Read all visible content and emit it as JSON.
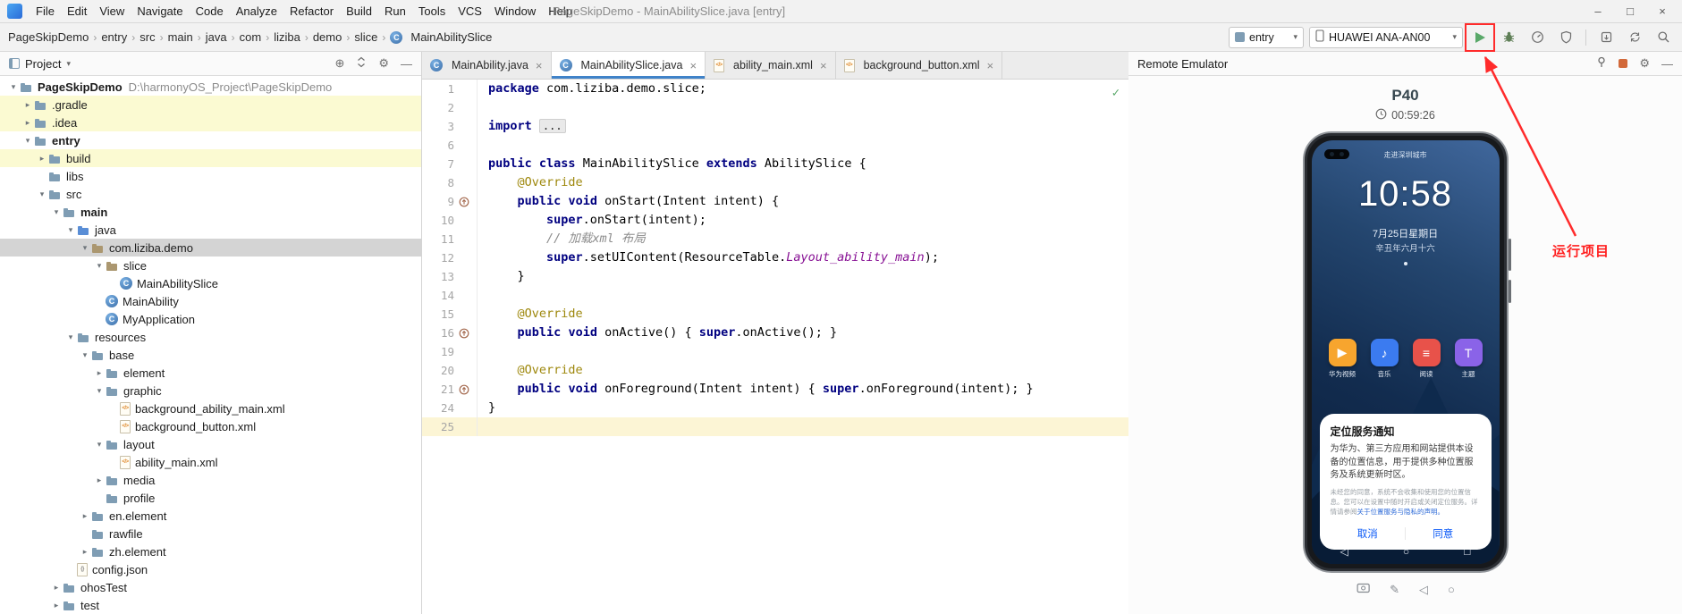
{
  "window": {
    "title": "PageSkipDemo - MainAbilitySlice.java [entry]",
    "menu_items": [
      "File",
      "Edit",
      "View",
      "Navigate",
      "Code",
      "Analyze",
      "Refactor",
      "Build",
      "Run",
      "Tools",
      "VCS",
      "Window",
      "Help"
    ],
    "controls": {
      "minimize": "–",
      "maximize": "□",
      "close": "×"
    }
  },
  "toolbar": {
    "breadcrumbs": [
      "PageSkipDemo",
      "entry",
      "src",
      "main",
      "java",
      "com",
      "liziba",
      "demo",
      "slice",
      "MainAbilitySlice"
    ],
    "run_config": "entry",
    "device": "HUAWEI ANA-AN00"
  },
  "project": {
    "header": "Project",
    "tree": [
      {
        "label": "PageSkipDemo",
        "sub": "D:\\harmonyOS_Project\\PageSkipDemo",
        "d": 0,
        "ic": "dir",
        "ch": "v",
        "bold": true
      },
      {
        "label": ".gradle",
        "d": 1,
        "ic": "dir",
        "ch": ">",
        "bg": "ex"
      },
      {
        "label": ".idea",
        "d": 1,
        "ic": "dir",
        "ch": ">",
        "bg": "ex"
      },
      {
        "label": "entry",
        "d": 1,
        "ic": "dir",
        "ch": "v",
        "bold": true
      },
      {
        "label": "build",
        "d": 2,
        "ic": "dir",
        "ch": ">",
        "bg": "ex"
      },
      {
        "label": "libs",
        "d": 2,
        "ic": "dir",
        "ch": ""
      },
      {
        "label": "src",
        "d": 2,
        "ic": "dir",
        "ch": "v"
      },
      {
        "label": "main",
        "d": 3,
        "ic": "dir",
        "ch": "v",
        "bold": true
      },
      {
        "label": "java",
        "d": 4,
        "ic": "dirsrc",
        "ch": "v"
      },
      {
        "label": "com.liziba.demo",
        "d": 5,
        "ic": "pkg",
        "ch": "v",
        "bg": "sel"
      },
      {
        "label": "slice",
        "d": 6,
        "ic": "pkg",
        "ch": "v"
      },
      {
        "label": "MainAbilitySlice",
        "d": 7,
        "ic": "cls",
        "ch": ""
      },
      {
        "label": "MainAbility",
        "d": 6,
        "ic": "cls",
        "ch": ""
      },
      {
        "label": "MyApplication",
        "d": 6,
        "ic": "cls",
        "ch": ""
      },
      {
        "label": "resources",
        "d": 4,
        "ic": "dir",
        "ch": "v"
      },
      {
        "label": "base",
        "d": 5,
        "ic": "dir",
        "ch": "v"
      },
      {
        "label": "element",
        "d": 6,
        "ic": "dir",
        "ch": ">"
      },
      {
        "label": "graphic",
        "d": 6,
        "ic": "dir",
        "ch": "v"
      },
      {
        "label": "background_ability_main.xml",
        "d": 7,
        "ic": "xml",
        "ch": ""
      },
      {
        "label": "background_button.xml",
        "d": 7,
        "ic": "xml",
        "ch": ""
      },
      {
        "label": "layout",
        "d": 6,
        "ic": "dir",
        "ch": "v"
      },
      {
        "label": "ability_main.xml",
        "d": 7,
        "ic": "xml",
        "ch": ""
      },
      {
        "label": "media",
        "d": 6,
        "ic": "dir",
        "ch": ">"
      },
      {
        "label": "profile",
        "d": 6,
        "ic": "dir",
        "ch": ""
      },
      {
        "label": "en.element",
        "d": 5,
        "ic": "dir",
        "ch": ">"
      },
      {
        "label": "rawfile",
        "d": 5,
        "ic": "dir",
        "ch": ""
      },
      {
        "label": "zh.element",
        "d": 5,
        "ic": "dir",
        "ch": ">"
      },
      {
        "label": "config.json",
        "d": 4,
        "ic": "json",
        "ch": ""
      },
      {
        "label": "ohosTest",
        "d": 3,
        "ic": "dir",
        "ch": ">"
      },
      {
        "label": "test",
        "d": 3,
        "ic": "dir",
        "ch": ">"
      }
    ]
  },
  "editor": {
    "tabs": [
      {
        "label": "MainAbility.java",
        "ic": "cls"
      },
      {
        "label": "MainAbilitySlice.java",
        "ic": "cls",
        "active": true
      },
      {
        "label": "ability_main.xml",
        "ic": "xml"
      },
      {
        "label": "background_button.xml",
        "ic": "xml"
      }
    ],
    "lines": [
      {
        "n": 1,
        "t": [
          [
            "kw",
            "package"
          ],
          [
            "pl",
            " com.liziba.demo.slice;"
          ]
        ]
      },
      {
        "n": 2,
        "t": []
      },
      {
        "n": 3,
        "t": [
          [
            "kw",
            "import"
          ],
          [
            "pl",
            " "
          ],
          [
            "fd",
            "..."
          ]
        ]
      },
      {
        "n": 6,
        "t": []
      },
      {
        "n": 7,
        "t": [
          [
            "kw",
            "public"
          ],
          [
            "pl",
            " "
          ],
          [
            "kw",
            "class"
          ],
          [
            "pl",
            " MainAbilitySlice "
          ],
          [
            "kw",
            "extends"
          ],
          [
            "pl",
            " AbilitySlice {"
          ]
        ]
      },
      {
        "n": 8,
        "t": [
          [
            "pl",
            "    "
          ],
          [
            "an",
            "@Override"
          ]
        ]
      },
      {
        "n": 9,
        "g": "o",
        "t": [
          [
            "pl",
            "    "
          ],
          [
            "kw",
            "public"
          ],
          [
            "pl",
            " "
          ],
          [
            "kw",
            "void"
          ],
          [
            "pl",
            " onStart(Intent intent) {"
          ]
        ]
      },
      {
        "n": 10,
        "t": [
          [
            "pl",
            "        "
          ],
          [
            "kw",
            "super"
          ],
          [
            "pl",
            ".onStart(intent);"
          ]
        ]
      },
      {
        "n": 11,
        "t": [
          [
            "pl",
            "        "
          ],
          [
            "cm",
            "// 加载xml 布局"
          ]
        ]
      },
      {
        "n": 12,
        "t": [
          [
            "pl",
            "        "
          ],
          [
            "kw",
            "super"
          ],
          [
            "pl",
            ".setUIContent(ResourceTable."
          ],
          [
            "st",
            "Layout_ability_main"
          ],
          [
            "pl",
            ");"
          ]
        ]
      },
      {
        "n": 13,
        "t": [
          [
            "pl",
            "    }"
          ]
        ]
      },
      {
        "n": 14,
        "t": []
      },
      {
        "n": 15,
        "t": [
          [
            "pl",
            "    "
          ],
          [
            "an",
            "@Override"
          ]
        ]
      },
      {
        "n": 16,
        "g": "o",
        "t": [
          [
            "pl",
            "    "
          ],
          [
            "kw",
            "public"
          ],
          [
            "pl",
            " "
          ],
          [
            "kw",
            "void"
          ],
          [
            "pl",
            " onActive() { "
          ],
          [
            "kw",
            "super"
          ],
          [
            "pl",
            ".onActive(); }"
          ]
        ]
      },
      {
        "n": 19,
        "t": []
      },
      {
        "n": 20,
        "t": [
          [
            "pl",
            "    "
          ],
          [
            "an",
            "@Override"
          ]
        ]
      },
      {
        "n": 21,
        "g": "o",
        "t": [
          [
            "pl",
            "    "
          ],
          [
            "kw",
            "public"
          ],
          [
            "pl",
            " "
          ],
          [
            "kw",
            "void"
          ],
          [
            "pl",
            " onForeground(Intent intent) { "
          ],
          [
            "kw",
            "super"
          ],
          [
            "pl",
            ".onForeground(intent); }"
          ]
        ]
      },
      {
        "n": 24,
        "t": [
          [
            "pl",
            "}"
          ]
        ]
      },
      {
        "n": 25,
        "cur": true,
        "t": []
      }
    ]
  },
  "emulator": {
    "title": "Remote Emulator",
    "device": "P40",
    "uptime": "00:59:26",
    "phone": {
      "carrier_text": "走进深圳城市",
      "time": "10:58",
      "date": "7月25日星期日",
      "lunar": "辛丑年六月十六",
      "apps": [
        {
          "label": "华为视频",
          "color": "#f7a52e",
          "glyph": "▶"
        },
        {
          "label": "音乐",
          "color": "#3b7bf0",
          "glyph": "♪"
        },
        {
          "label": "阅读",
          "color": "#e8524a",
          "glyph": "≡"
        },
        {
          "label": "主题",
          "color": "#8a63e8",
          "glyph": "T"
        }
      ],
      "dialog": {
        "title": "定位服务通知",
        "body": "为华为、第三方应用和网站提供本设备的位置信息，用于提供多种位置服务及系统更新时区。",
        "note": "未经您的同意，系统不会收集和使用您的位置信息。您可以在设置中随时开启或关闭定位服务。详情请参阅",
        "link": "关于位置服务与隐私的声明。",
        "cancel": "取消",
        "confirm": "同意"
      }
    }
  },
  "annotation": {
    "label": "运行项目"
  },
  "colors": {
    "annotation_red": "#ff2b2b",
    "run_green": "#59a869",
    "active_tab_underline": "#4083c9",
    "keyword_navy": "#000080",
    "excluded_row_yellow": "#fbfad2"
  },
  "icons": {
    "run": "green-play-triangle",
    "debug": "bug",
    "search": "magnifier",
    "settings": "gear",
    "pin": "pushpin",
    "locate": "crosshair-circle"
  }
}
